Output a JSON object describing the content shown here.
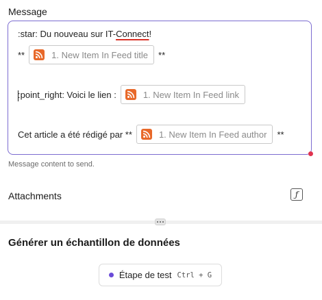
{
  "message_field": {
    "label": "Message",
    "line1": {
      "prefix": ":star: Du nouveau sur IT-",
      "underlined": "Connect",
      "suffix": " !"
    },
    "line2": {
      "before": "**",
      "pill": "1. New Item In Feed title",
      "after": "**"
    },
    "line3": {
      "before": ":point_right: Voici le lien :",
      "pill": "1. New Item In Feed link"
    },
    "line4": {
      "before": "Cet article a été rédigé par **",
      "pill": "1. New Item In Feed author",
      "after": "**"
    },
    "helper": "Message content to send."
  },
  "attachments": {
    "label": "Attachments",
    "fx_icon": "ƒ"
  },
  "sample": {
    "title": "Générer un échantillon de données",
    "button_label": "Étape de test",
    "shortcut": "Ctrl + G"
  },
  "colors": {
    "editor_border": "#7b6bd0",
    "rss_icon": "#e8692a",
    "status_dot": "#6a4bd8",
    "resize_dot": "#e0334f"
  },
  "icons": {
    "pill_icon": "rss-icon",
    "attachments_toggle": "function-icon",
    "divider": "drag-handle-icon"
  }
}
